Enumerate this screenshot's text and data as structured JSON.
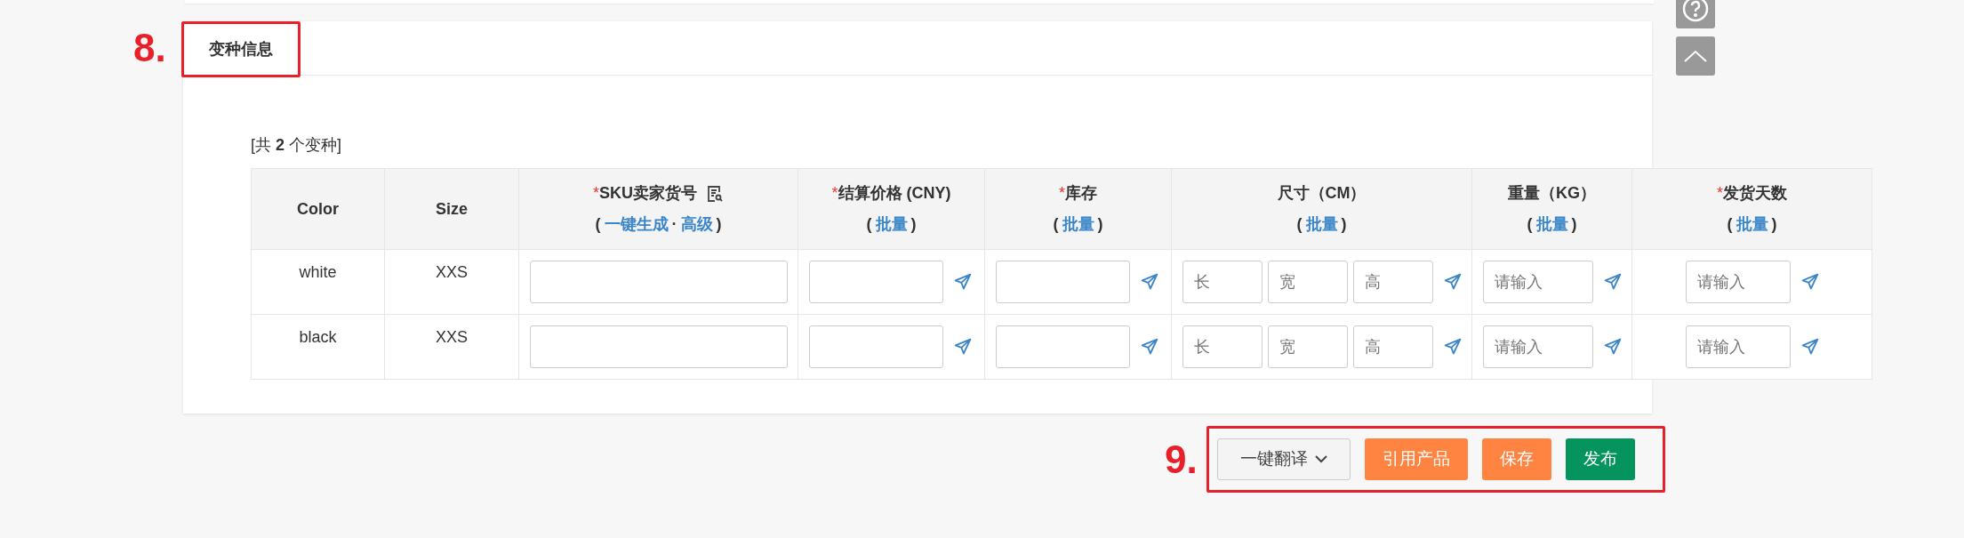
{
  "section": {
    "annotation": "8.",
    "title": "变种信息"
  },
  "summary": "[共 **2** 个变种]",
  "table": {
    "bracket_open": "(",
    "bracket_close": ")",
    "link_separator": "·",
    "columns": [
      {
        "label": "Color"
      },
      {
        "label": "Size"
      },
      {
        "label": "SKU卖家货号",
        "required_mark": "*",
        "has_icon": true,
        "links": [
          "一键生成",
          "高级"
        ]
      },
      {
        "label": "结算价格 (CNY)",
        "required_mark": "*",
        "links": [
          "批量"
        ]
      },
      {
        "label": "库存",
        "required_mark": "*",
        "links": [
          "批量"
        ]
      },
      {
        "label": "尺寸（CM）",
        "links": [
          "批量"
        ]
      },
      {
        "label": "重量（KG）",
        "links": [
          "批量"
        ]
      },
      {
        "label": "发货天数",
        "required_mark": "*",
        "links": [
          "批量"
        ]
      }
    ],
    "rows": [
      {
        "cells": [
          {
            "kind": "text",
            "value": "white"
          },
          {
            "kind": "text",
            "value": "XXS"
          },
          {
            "kind": "input"
          },
          {
            "kind": "input_send"
          },
          {
            "kind": "input_send"
          },
          {
            "kind": "dims",
            "placeholders": [
              "长",
              "宽",
              "高"
            ]
          },
          {
            "kind": "input_send",
            "placeholder": "请输入"
          },
          {
            "kind": "input_send_center",
            "placeholder": "请输入"
          }
        ]
      },
      {
        "cells": [
          {
            "kind": "text",
            "value": "black"
          },
          {
            "kind": "text",
            "value": "XXS"
          },
          {
            "kind": "input"
          },
          {
            "kind": "input_send"
          },
          {
            "kind": "input_send"
          },
          {
            "kind": "dims",
            "placeholders": [
              "长",
              "宽",
              "高"
            ]
          },
          {
            "kind": "input_send",
            "placeholder": "请输入"
          },
          {
            "kind": "input_send_center",
            "placeholder": "请输入"
          }
        ]
      }
    ]
  },
  "footer": {
    "annotation": "9.",
    "buttons": [
      {
        "label": "一键翻译",
        "kind": "dropdown"
      },
      {
        "label": "引用产品",
        "kind": "warning"
      },
      {
        "label": "保存",
        "kind": "warning"
      },
      {
        "label": "发布",
        "kind": "primary"
      }
    ]
  }
}
